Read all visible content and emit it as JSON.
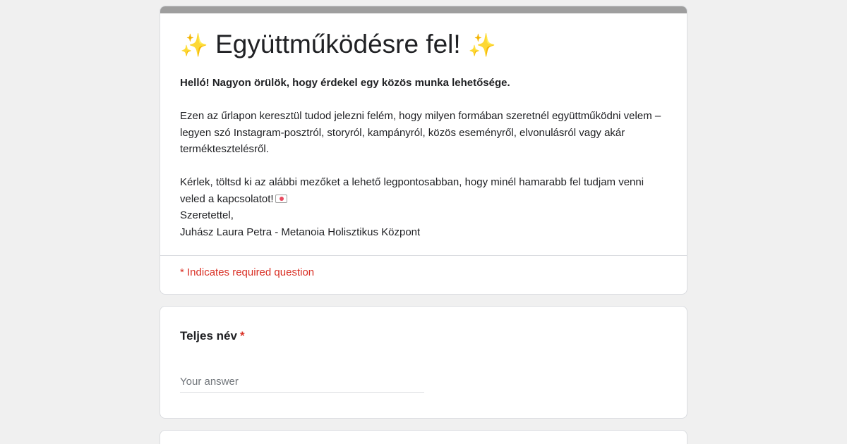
{
  "form": {
    "title_emoji": "✨",
    "title": "Együttműködésre fel!",
    "description": {
      "lead": "Helló! Nagyon örülök, hogy érdekel egy közös munka lehetősége.",
      "paragraph1": "Ezen az űrlapon keresztül tudod jelezni felém, hogy milyen formában szeretnél együttműködni velem – legyen szó Instagram-posztról, storyról, kampányról, közös eseményről, elvonulásról vagy akár terméktesztelésről.",
      "paragraph2": "Kérlek, töltsd ki az alábbi mezőket a lehető legpontosabban, hogy minél hamarabb fel tudjam venni veled a kapcsolatot!",
      "closing": "Szeretettel,",
      "signature": "Juhász Laura Petra - Metanoia Holisztikus Központ"
    },
    "required_note": "* Indicates required question"
  },
  "questions": [
    {
      "label": "Teljes név",
      "required_mark": "*",
      "placeholder": "Your answer",
      "value": ""
    }
  ],
  "icons": {
    "title_decoration": "sparkles-icon",
    "envelope": "love-letter-icon"
  },
  "colors": {
    "header_bar": "#9e9e9e",
    "required": "#d93025",
    "background": "#f0f0f0",
    "sparkle": "#f2c230"
  }
}
